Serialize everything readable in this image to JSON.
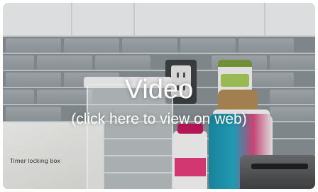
{
  "video": {
    "title": "Video",
    "subtitle": "(click here to view on web)"
  },
  "scene": {
    "box_label": "Timer locking box"
  },
  "colors": {
    "overlay_text": "#ffffff",
    "tile_gray": "#959da1",
    "grout": "#c9cdcf"
  },
  "icons": {
    "outlet": "wall-outlet-icon"
  }
}
